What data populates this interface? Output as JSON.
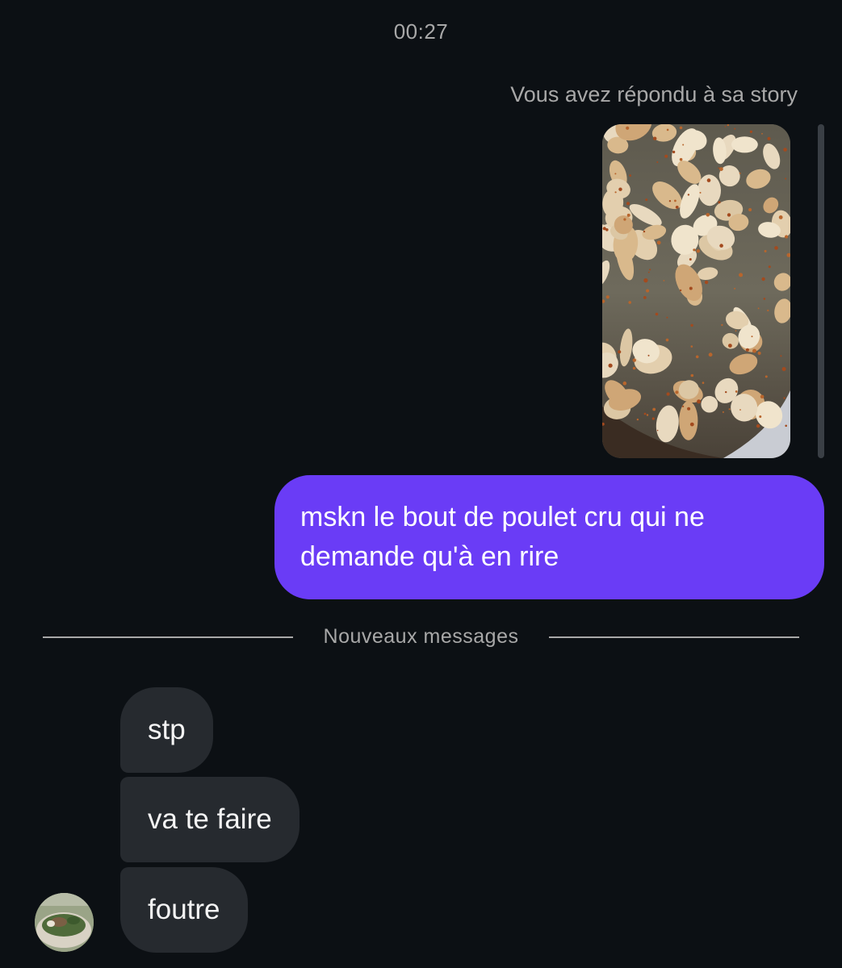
{
  "thread": {
    "timestamp": "00:27",
    "story_reply_caption": "Vous avez répondu à sa story",
    "story_thumbnail_icon": "story-photo-cooked-chicken",
    "sent_message": "mskn le bout de poulet cru qui ne demande qu'à en rire",
    "new_messages_label": "Nouveaux messages",
    "received_messages": [
      "stp",
      "va te faire",
      "foutre"
    ],
    "sender_avatar_icon": "avatar-plant-bowl"
  },
  "colors": {
    "background": "#0c1014",
    "sent_bubble": "#6a3cf6",
    "received_bubble": "#262a2f",
    "secondary_text": "#a8a8a8"
  }
}
